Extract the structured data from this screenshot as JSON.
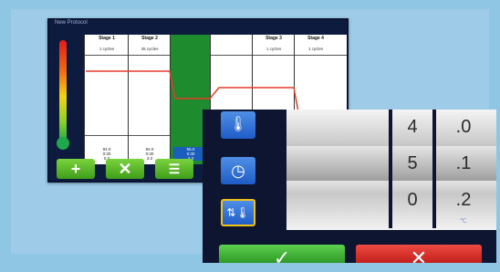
{
  "back_screen": {
    "title": "New Protocol",
    "stages": [
      {
        "name": "Stage 1",
        "cycles": "1 cycles",
        "vals": [
          "94.0",
          "0:30",
          "0.3"
        ]
      },
      {
        "name": "Stage 2",
        "cycles": "35 cycles",
        "vals": [
          "94.0",
          "0:30",
          "3.3"
        ]
      },
      {
        "name": "",
        "cycles": "",
        "vals": [
          "55.0",
          "0:30",
          "3.3"
        ]
      },
      {
        "name": "",
        "cycles": "",
        "vals": [
          "",
          "",
          ""
        ]
      },
      {
        "name": "Stage 3",
        "cycles": "1 cycles",
        "vals": [
          "",
          "",
          ""
        ]
      },
      {
        "name": "Stage 4",
        "cycles": "1 cycles",
        "vals": [
          "",
          "",
          ""
        ]
      }
    ],
    "buttons": [
      {
        "icon": "plus-icon",
        "glyph": "+"
      },
      {
        "icon": "close-icon",
        "glyph": "✕"
      },
      {
        "icon": "list-icon",
        "glyph": "☰"
      }
    ]
  },
  "dialog": {
    "side_buttons": [
      {
        "icon": "thermometer-icon",
        "glyph": "🌡"
      },
      {
        "icon": "clock-icon",
        "glyph": "◷"
      },
      {
        "icon": "ramp-rate-icon",
        "glyph": "⇅🌡"
      }
    ],
    "picker": {
      "rows": [
        {
          "int": "4",
          "dec": ".0"
        },
        {
          "int": "5",
          "dec": ".1"
        },
        {
          "int": "0",
          "dec": ".2"
        }
      ],
      "unit": "℃"
    },
    "ok_glyph": "✓",
    "cancel_glyph": "✕"
  }
}
